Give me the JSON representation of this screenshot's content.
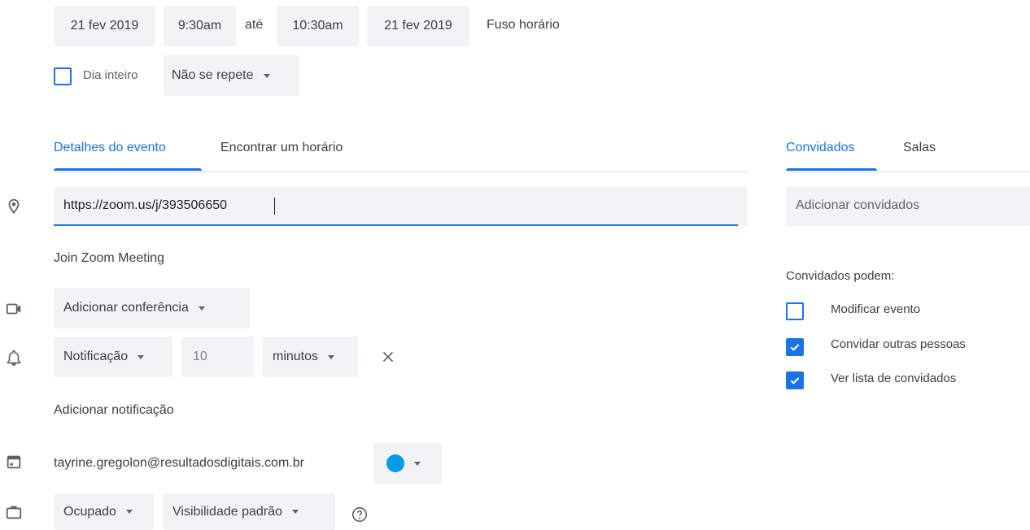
{
  "datetime": {
    "start_date": "21 fev 2019",
    "start_time": "9:30am",
    "until": "até",
    "end_time": "10:30am",
    "end_date": "21 fev 2019",
    "timezone": "Fuso horário"
  },
  "all_day": {
    "label": "Dia inteiro",
    "checked": false
  },
  "repeat": {
    "label": "Não se repete"
  },
  "tabs": {
    "details": "Detalhes do evento",
    "find_time": "Encontrar um horário",
    "guests": "Convidados",
    "rooms": "Salas"
  },
  "location": {
    "value": "https://zoom.us/j/393506650"
  },
  "description": {
    "text": "Join Zoom Meeting"
  },
  "conference": {
    "label": "Adicionar conferência"
  },
  "notification": {
    "type": "Notificação",
    "amount": "10",
    "unit": "minutos",
    "add_label": "Adicionar notificação"
  },
  "calendar": {
    "owner": "tayrine.gregolon@resultadosdigitais.com.br",
    "color": "#039be5"
  },
  "availability": {
    "status": "Ocupado",
    "visibility": "Visibilidade padrão"
  },
  "guests_panel": {
    "add_placeholder": "Adicionar convidados",
    "permissions_title": "Convidados podem:",
    "permissions": [
      {
        "label": "Modificar evento",
        "checked": false
      },
      {
        "label": "Convidar outras pessoas",
        "checked": true
      },
      {
        "label": "Ver lista de convidados",
        "checked": true
      }
    ]
  },
  "colors": {
    "accent": "#1a73e8",
    "chip_bg": "#f1f3f4",
    "icon": "#5f6368"
  }
}
